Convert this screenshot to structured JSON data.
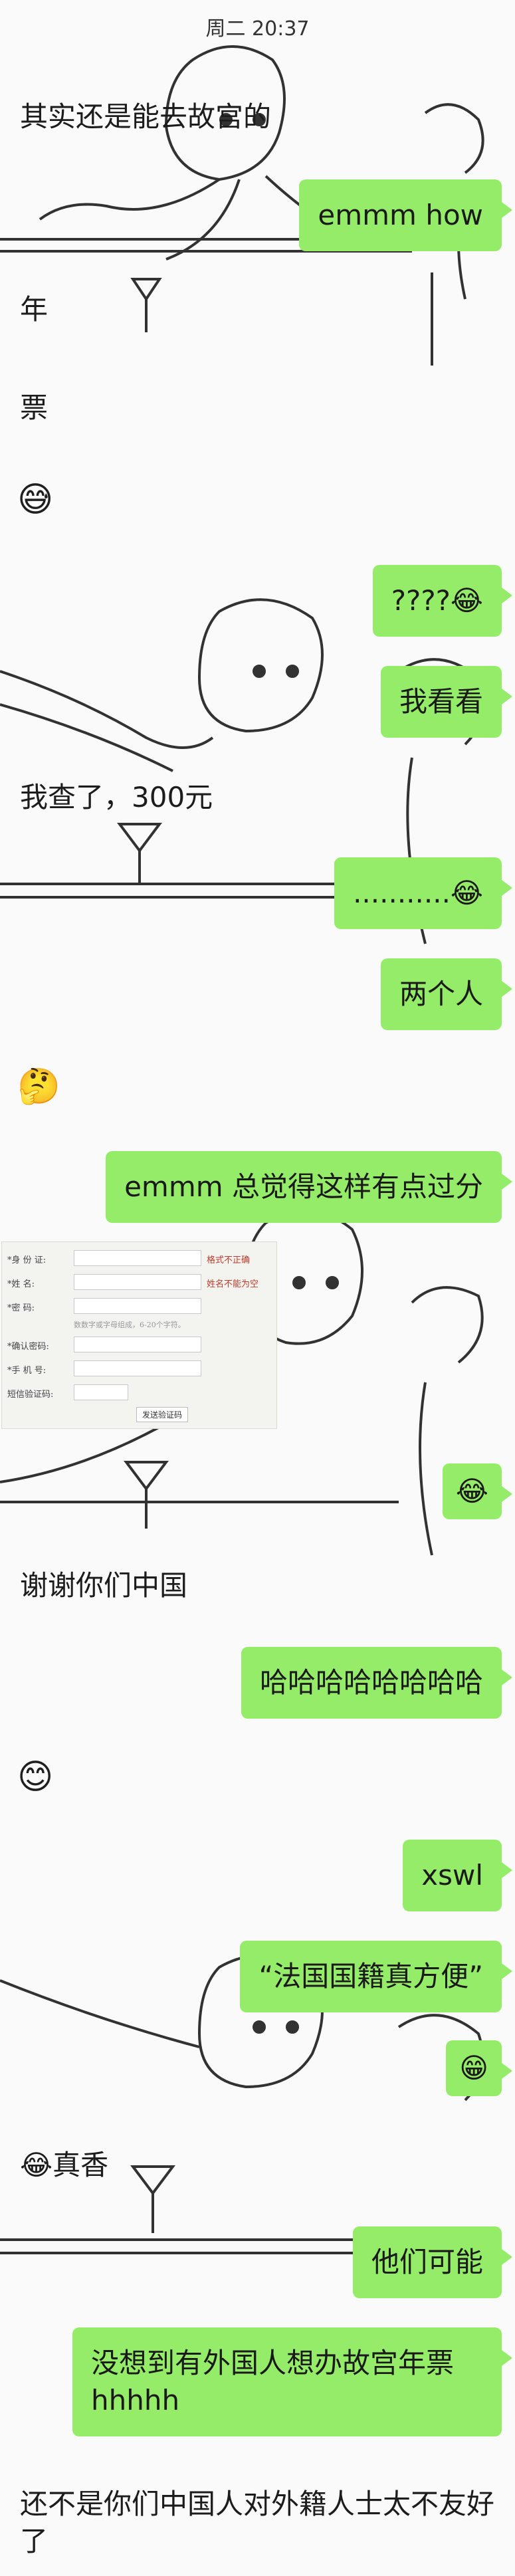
{
  "header": {
    "time": "周二 20:37"
  },
  "messages": {
    "m1": "其实还是能去故宫的",
    "m2": "emmm how",
    "m3": "年",
    "m4": "票",
    "m5": "😅",
    "m6": "????😂",
    "m7": "我看看",
    "m8": "我查了，300元",
    "m9": "...........😂",
    "m10": "两个人",
    "m11": "🤔",
    "m12": "emmm 总觉得这样有点过分",
    "m13": "😂",
    "m14": "谢谢你们中国",
    "m15": "哈哈哈哈哈哈哈哈",
    "m16": "😊",
    "m17": "xswl",
    "m18": "“法国国籍真方便”",
    "m19": "😁",
    "m20": "😂真香",
    "m21": "他们可能",
    "m22": "没想到有外国人想办故宫年票hhhhh",
    "m23": "还不是你们中国人对外籍人士太不友好了"
  },
  "form": {
    "rows": [
      {
        "label": "*身 份 证:",
        "error": "格式不正确"
      },
      {
        "label": "*姓    名:",
        "error": "姓名不能为空"
      },
      {
        "label": "*密    码:",
        "error": ""
      },
      {
        "label": "*确认密码:",
        "error": ""
      },
      {
        "label": "*手 机 号:",
        "error": ""
      },
      {
        "label": "短信验证码:",
        "error": ""
      }
    ],
    "hint": "数数字或字母组成，6-20个字符。",
    "send_button": "发送验证码"
  }
}
